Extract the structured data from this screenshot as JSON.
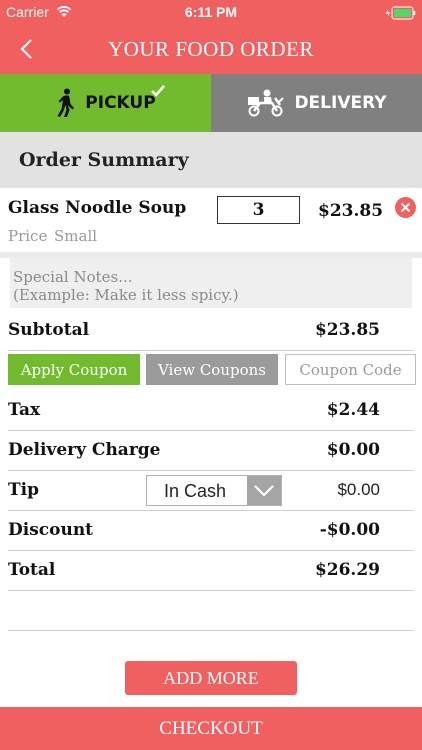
{
  "status_bar": {
    "carrier": "Carrier",
    "time": "6:11 PM"
  },
  "nav": {
    "title": "YOUR FOOD ORDER"
  },
  "tabs": {
    "pickup": "PICKUP",
    "delivery": "DELIVERY"
  },
  "summary": {
    "title": "Order Summary"
  },
  "item": {
    "name": "Glass Noodle Soup",
    "quantity": "3",
    "total": "$23.85",
    "price_label": "Price",
    "size": "Small"
  },
  "notes": {
    "placeholder_line1": "Special Notes...",
    "placeholder_line2": "(Example: Make it less spicy.)"
  },
  "subtotal": {
    "label": "Subtotal",
    "value": "$23.85"
  },
  "coupon": {
    "apply_label": "Apply Coupon",
    "view_label": "View Coupons",
    "code_placeholder": "Coupon Code"
  },
  "tax": {
    "label": "Tax",
    "value": "$2.44"
  },
  "delivery_charge": {
    "label": "Delivery Charge",
    "value": "$0.00"
  },
  "tip": {
    "label": "Tip",
    "method": "In Cash",
    "value": "$0.00"
  },
  "discount": {
    "label": "Discount",
    "value": "-$0.00"
  },
  "total": {
    "label": "Total",
    "value": "$26.29"
  },
  "actions": {
    "add_more": "ADD MORE",
    "checkout": "CHECKOUT"
  },
  "colors": {
    "brand": "#f06060",
    "pickup_active": "#73bb2e",
    "delivery_inactive": "#808080",
    "remove": "#f06060"
  }
}
